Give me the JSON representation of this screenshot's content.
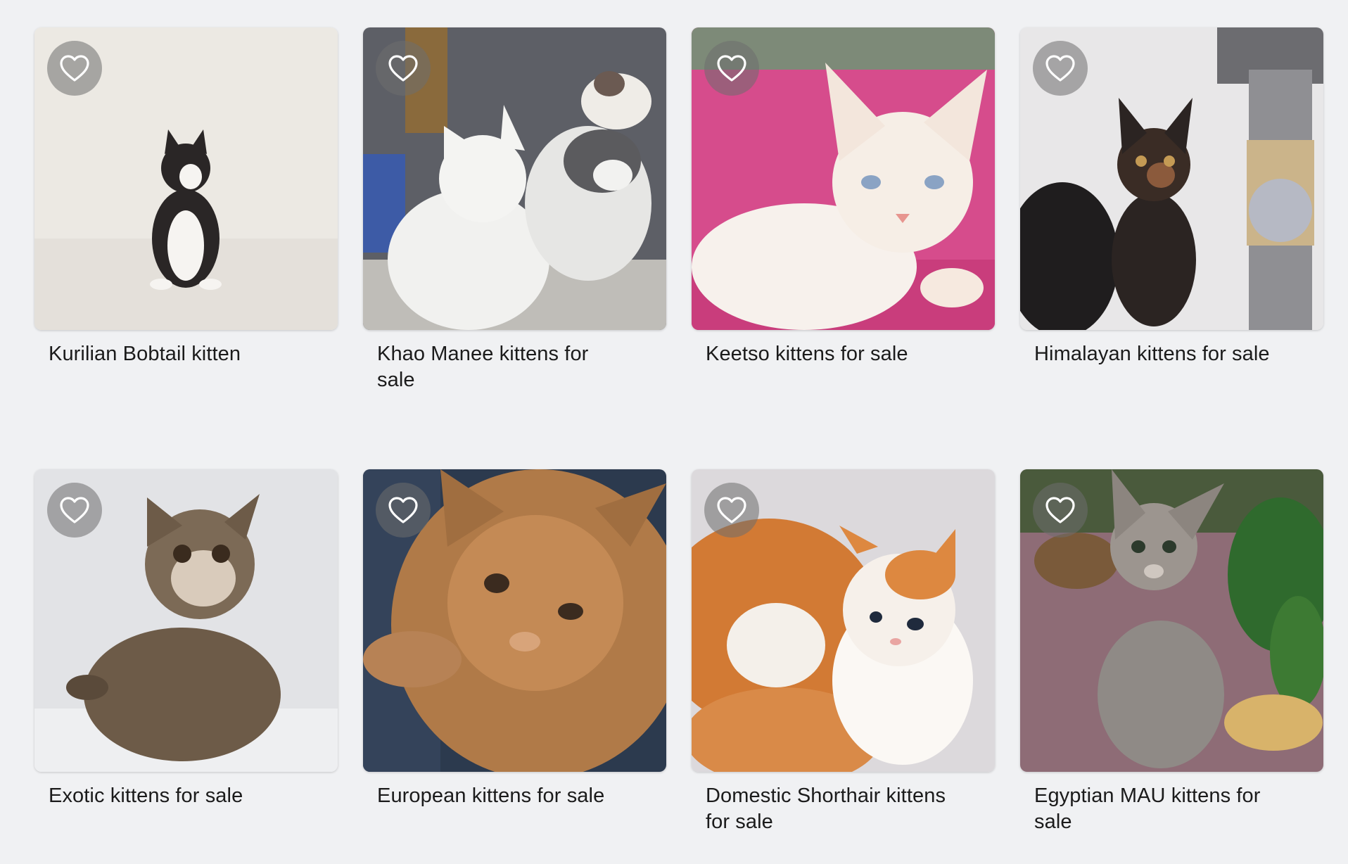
{
  "listings": [
    {
      "title": "Kurilian Bobtail kitten",
      "favorite_icon": "heart-outline-icon"
    },
    {
      "title": "Khao Manee kittens for sale",
      "favorite_icon": "heart-outline-icon"
    },
    {
      "title": "Keetso kittens for sale",
      "favorite_icon": "heart-outline-icon"
    },
    {
      "title": "Himalayan kittens for sale",
      "favorite_icon": "heart-outline-icon"
    },
    {
      "title": "Exotic kittens for sale",
      "favorite_icon": "heart-outline-icon"
    },
    {
      "title": "European kittens for sale",
      "favorite_icon": "heart-outline-icon"
    },
    {
      "title": "Domestic Shorthair kittens for sale",
      "favorite_icon": "heart-outline-icon"
    },
    {
      "title": "Egyptian MAU kittens for sale",
      "favorite_icon": "heart-outline-icon"
    }
  ],
  "colors": {
    "page_background": "#f0f1f3",
    "title_text": "#1b1b1b",
    "favorite_badge": "#6e6e6e"
  }
}
